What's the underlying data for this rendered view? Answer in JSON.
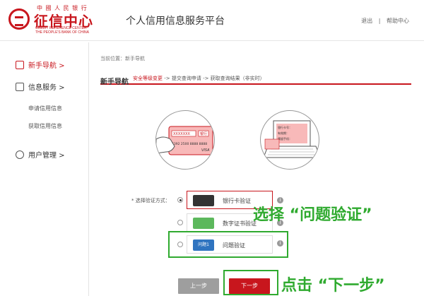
{
  "header": {
    "logo_top": "中 國 人 民 银 行",
    "logo_main": "征信中心",
    "logo_en_line1": "CREDIT REFERENCE CENTER",
    "logo_en_line2": "THE PEOPLE'S BANK OF CHINA",
    "platform_title": "个人信用信息服务平台",
    "logout": "退出",
    "separator": "|",
    "help": "帮助中心"
  },
  "sidebar": {
    "nav_guide": "新手导航 >",
    "info_service": "信息服务 >",
    "apply_credit": "申请信用信息",
    "get_credit": "获取信用信息",
    "user_manage": "用户管理 >"
  },
  "main": {
    "breadcrumb": "当前位置：新手导航",
    "title": "新手导航",
    "step_current": "安全等级变更",
    "step_rest": " -> 提交查询申请 -> 获取查询结果（非实时）",
    "verify_label": "* 选择验证方式：",
    "options": [
      {
        "label": "银行卡验证",
        "icon": "bank-card-icon"
      },
      {
        "label": "数字证书验证",
        "icon": "digital-cert-icon"
      },
      {
        "label": "问题验证",
        "icon": "question-verify-icon",
        "icon_text": "问题1"
      }
    ],
    "card_texts": {
      "card_mask": "XXXXXXX",
      "card_bank": "银行",
      "card_number": "4392 2500 8888 8888",
      "card_brand": "VISA",
      "form_line1": "银行卡号：",
      "form_line2": "有效期：",
      "form_line3": "预留手机："
    },
    "prev_button": "上一步",
    "next_button": "下一步"
  },
  "annotations": {
    "choose_text": "选择 “问题验证”",
    "click_text": "点击 “下一步”",
    "color": "#2faa2f"
  },
  "colors": {
    "brand_red": "#c8161d"
  }
}
